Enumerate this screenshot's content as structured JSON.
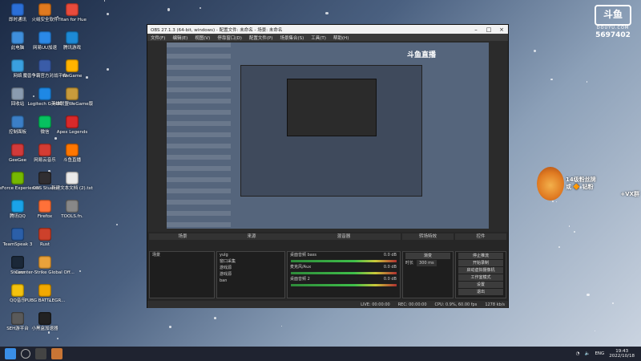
{
  "desktop": {
    "icons": [
      {
        "label": "即时通讯",
        "color": "#2b6fd8"
      },
      {
        "label": "此电脑",
        "color": "#3f8fdc"
      },
      {
        "label": "网络",
        "color": "#3aa0e0"
      },
      {
        "label": "回收站",
        "color": "#8a9bb0"
      },
      {
        "label": "控制面板",
        "color": "#3b7fc7"
      },
      {
        "label": "GeeGee",
        "color": "#d23a3a"
      },
      {
        "label": "GeForce Experience",
        "color": "#76b900"
      },
      {
        "label": "腾讯QQ",
        "color": "#1aa3e8"
      },
      {
        "label": "TeamSpeak 3",
        "color": "#2b5fa8"
      },
      {
        "label": "Steam",
        "color": "#1b2838"
      },
      {
        "label": "QQ音乐",
        "color": "#f4c20d"
      },
      {
        "label": "SEH游平台",
        "color": "#5a5a5a"
      },
      {
        "label": "火绒安全软件",
        "color": "#e07a1f"
      },
      {
        "label": "网易UU加速",
        "color": "#2b89e8"
      },
      {
        "label": "魔兽争霸官方对战平台",
        "color": "#3a5ca8"
      },
      {
        "label": "Logitech G HUB",
        "color": "#1e88e5"
      },
      {
        "label": "微信",
        "color": "#07c160"
      },
      {
        "label": "网易云音乐",
        "color": "#d43c33"
      },
      {
        "label": "OBS Studio",
        "color": "#302e31"
      },
      {
        "label": "Firefox",
        "color": "#ff7139"
      },
      {
        "label": "Rust",
        "color": "#cd412b"
      },
      {
        "label": "Counter-Strike Global Off...",
        "color": "#e9a23b"
      },
      {
        "label": "PUBG BATTLEGR...",
        "color": "#f2a900"
      },
      {
        "label": "小黑盒加速器",
        "color": "#222"
      },
      {
        "label": "Titan for Hue",
        "color": "#e94b3c"
      },
      {
        "label": "腾讯游戏",
        "color": "#1d8ad6"
      },
      {
        "label": "WeGame",
        "color": "#ffb400"
      },
      {
        "label": "英雄联盟WeGame版",
        "color": "#c89b3c"
      },
      {
        "label": "Apex Legends",
        "color": "#da292a"
      },
      {
        "label": "斗鱼直播",
        "color": "#ff7700"
      },
      {
        "label": "新建文本文档 (2).txt",
        "color": "#eaeaea"
      },
      {
        "label": "TOOLS.fn.",
        "color": "#888"
      }
    ]
  },
  "obs": {
    "title": "OBS 27.1.3 (64-bit, windows) - 配置文件: 未命名 - 场景: 未命名",
    "menu": [
      "文件(F)",
      "编辑(E)",
      "视图(V)",
      "停靠窗口(D)",
      "配置文件(P)",
      "场景集合(S)",
      "工具(T)",
      "帮助(H)"
    ],
    "preview_banner": "斗鱼直播",
    "docks": {
      "scenes_header": "场景",
      "sources_header": "来源",
      "mixer_header": "混音器",
      "transitions_header": "转场特效",
      "controls_header": "控件",
      "scene_items": [
        "场景"
      ],
      "source_items": [
        "yulg",
        "窗口采集",
        "游戏源",
        "游戏源",
        "ban"
      ],
      "mixer_channels": [
        {
          "name": "桌面音频 bass",
          "db": "0.0 dB"
        },
        {
          "name": "麦克风/Aux",
          "db": "0.0 dB"
        },
        {
          "name": "桌面音频 2",
          "db": "0.0 dB"
        }
      ],
      "transition": "渐变",
      "duration_label": "时长",
      "duration": "300 ms",
      "controls": [
        "停止推流",
        "开始录制",
        "启动虚拟摄像机",
        "工作室模式",
        "设置",
        "退出"
      ]
    },
    "status": {
      "live": "LIVE: 00:00:00",
      "rec": "REC: 00:00:00",
      "cpu": "CPU: 0.9%, 60.00 fps",
      "kbps": "1278 kb/s"
    }
  },
  "douyu": {
    "logo": "斗鱼",
    "site": "DOUYU.COM",
    "room": "5697402"
  },
  "fan_badge": {
    "line1": "14级粉丝牌",
    "line2": "或 🔶 钻粉",
    "line3": "+VX群"
  },
  "taskbar": {
    "time": "19:43",
    "date": "2022/10/18",
    "lang": "ENG"
  }
}
